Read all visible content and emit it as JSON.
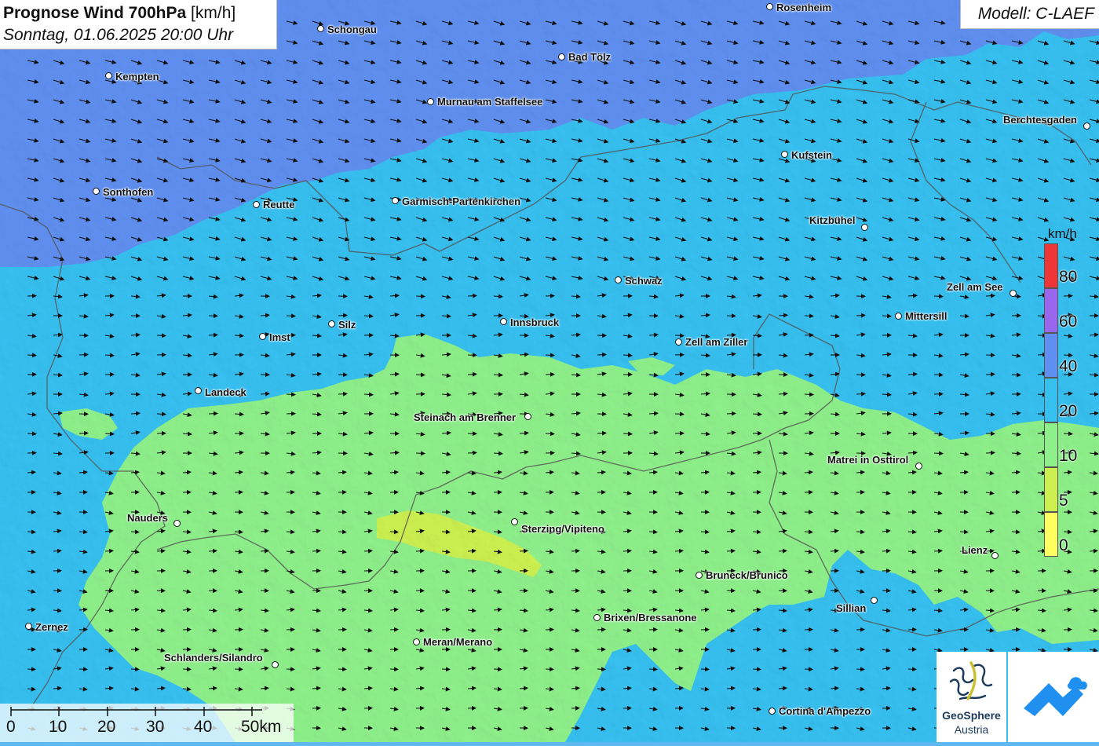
{
  "header": {
    "title_bold": "Prognose Wind 700hPa",
    "title_unit": "[km/h]",
    "subtitle": "Sonntag, 01.06.2025 20:00 Uhr"
  },
  "model": {
    "label": "Modell: C-LAEF"
  },
  "legend": {
    "unit": "km/h",
    "levels": [
      {
        "label": "80",
        "color": "#ee3636"
      },
      {
        "label": "60",
        "color": "#9966ee"
      },
      {
        "label": "40",
        "color": "#5f8ff0"
      },
      {
        "label": "20",
        "color": "#36c0f0"
      },
      {
        "label": "10",
        "color": "#8ef08a"
      },
      {
        "label": "5",
        "color": "#ccf050"
      },
      {
        "label": "0",
        "color": "#ffff60"
      }
    ]
  },
  "scale": {
    "labels": [
      "0",
      "10",
      "20",
      "30",
      "40",
      "50km"
    ]
  },
  "cities": [
    {
      "name": "Rosenheim"
    },
    {
      "name": "Schongau"
    },
    {
      "name": "Bad Tölz"
    },
    {
      "name": "Kempten"
    },
    {
      "name": "Murnau am Staffelsee"
    },
    {
      "name": "Berchtesgaden"
    },
    {
      "name": "Kufstein"
    },
    {
      "name": "Sonthofen"
    },
    {
      "name": "Reutte"
    },
    {
      "name": "Garmisch-Partenkirchen"
    },
    {
      "name": "Kitzbühel"
    },
    {
      "name": "Schwaz"
    },
    {
      "name": "Zell am See"
    },
    {
      "name": "Mittersill"
    },
    {
      "name": "Silz"
    },
    {
      "name": "Innsbruck"
    },
    {
      "name": "Imst"
    },
    {
      "name": "Zell am Ziller"
    },
    {
      "name": "Landeck"
    },
    {
      "name": "Steinach am Brenner"
    },
    {
      "name": "Matrei in Osttirol"
    },
    {
      "name": "Nauders"
    },
    {
      "name": "Sterzing/Vipiteno"
    },
    {
      "name": "Lienz"
    },
    {
      "name": "Bruneck/Brunico"
    },
    {
      "name": "Sillian"
    },
    {
      "name": "Brixen/Bressanone"
    },
    {
      "name": "Zernez"
    },
    {
      "name": "Meran/Merano"
    },
    {
      "name": "Schlanders/Silandro"
    },
    {
      "name": "Cortina d'Ampezzo"
    }
  ],
  "logos": {
    "geosphere_name": "GeoSphere",
    "geosphere_sub": "Austria"
  }
}
